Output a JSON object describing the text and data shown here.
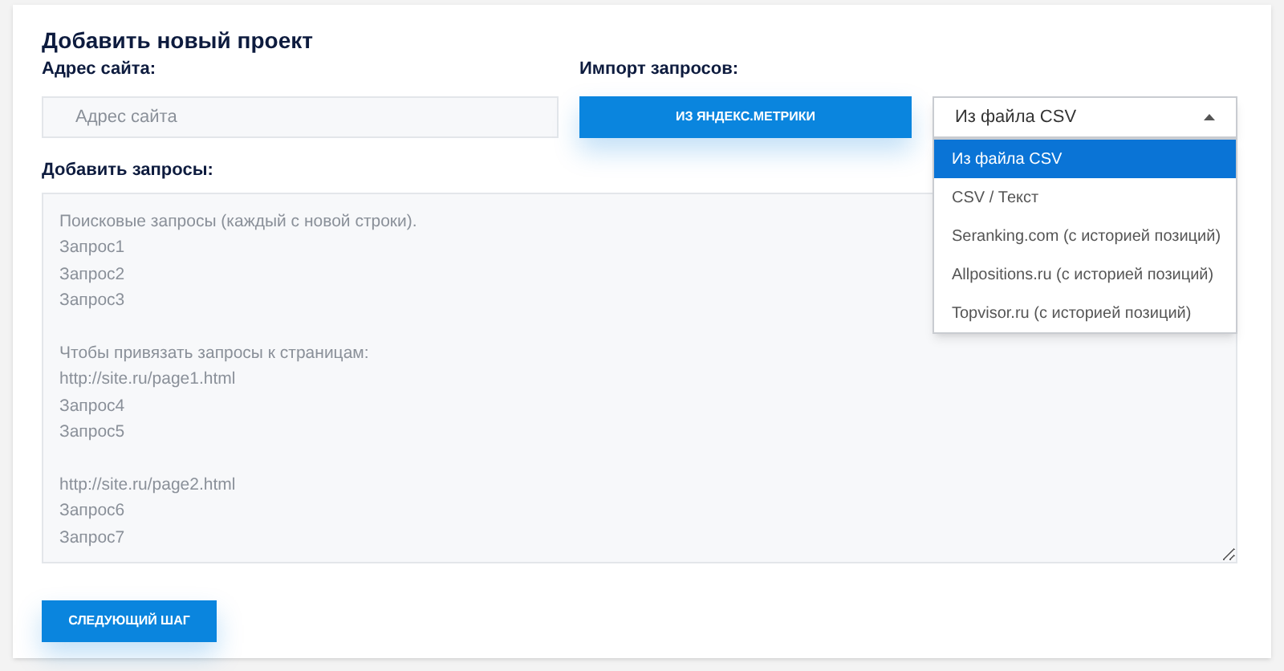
{
  "title": "Добавить новый проект",
  "site": {
    "label": "Адрес сайта:",
    "placeholder": "Адрес сайта"
  },
  "import": {
    "label": "Импорт запросов:",
    "button": "ИЗ ЯНДЕКС.МЕТРИКИ",
    "select": {
      "value": "Из файла CSV",
      "expanded": true,
      "options": [
        {
          "label": "Из файла CSV",
          "selected": true
        },
        {
          "label": "CSV / Текст",
          "selected": false
        },
        {
          "label": "Seranking.com (с историей позиций)",
          "selected": false
        },
        {
          "label": "Allpositions.ru (с историей позиций)",
          "selected": false
        },
        {
          "label": "Topvisor.ru (с историей позиций)",
          "selected": false
        }
      ]
    }
  },
  "queries": {
    "label": "Добавить запросы:",
    "placeholder": "Поисковые запросы (каждый с новой строки).\nЗапрос1\nЗапрос2\nЗапрос3\n\nЧтобы привязать запросы к страницам:\nhttp://site.ru/page1.html\nЗапрос4\nЗапрос5\n\nhttp://site.ru/page2.html\nЗапрос6\nЗапрос7"
  },
  "next_button": "СЛЕДУЮЩИЙ ШАГ"
}
